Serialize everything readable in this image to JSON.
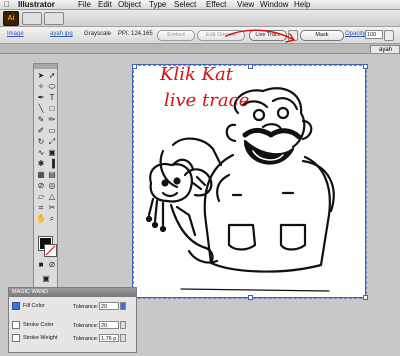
{
  "menubar": {
    "apple": "",
    "app_name": "Illustrator",
    "items": [
      "File",
      "Edit",
      "Object",
      "Type",
      "Select",
      "Effect",
      "View",
      "Window",
      "Help"
    ]
  },
  "appbar": {
    "logo": "Ai"
  },
  "control": {
    "image_link": "Image",
    "filename": "ayah.jpg",
    "mode": "Grayscale",
    "ppi": "PPI: 124.165",
    "embed": "Embed",
    "edit_original": "Edit Original",
    "live_trace": "Live Trace",
    "mask": "Mask",
    "opacity_label": "Opacity",
    "opacity_value": "100"
  },
  "document": {
    "tab": "ayah"
  },
  "annotation": {
    "line1": "Klik Kat",
    "line2": "live trace",
    "color": "#d90f0f"
  },
  "magic_wand": {
    "title": "MAGIC WAND",
    "fill_color": "Fill Color",
    "fill_tolerance_label": "Tolerance:",
    "fill_tolerance": "20",
    "stroke_color": "Stroke Color",
    "stroke_tolerance_label": "Tolerance:",
    "stroke_tolerance": "20",
    "stroke_weight": "Stroke Weight",
    "weight_tolerance_label": "Tolerance:",
    "weight_tolerance": "1.76 p"
  },
  "colors": {
    "accent": "#3f61b8",
    "ai_orange": "#ff9a00"
  }
}
